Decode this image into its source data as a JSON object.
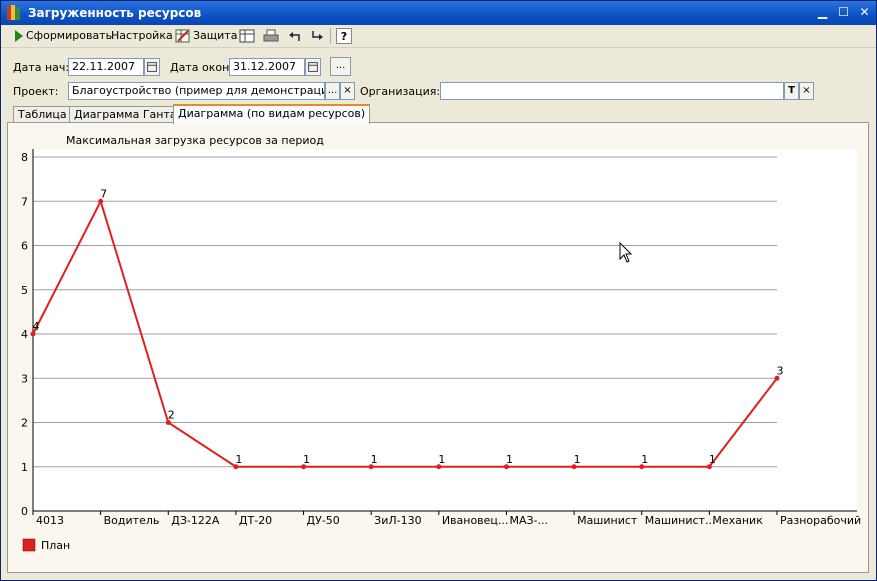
{
  "window": {
    "title": "Загруженность ресурсов"
  },
  "toolbar": {
    "form_label": "Сформировать",
    "settings_label": "Настройка",
    "protection_label": "Защита",
    "help_label": "?"
  },
  "filters": {
    "date_start_label": "Дата нач:",
    "date_start_value": "22.11.2007",
    "date_end_label": "Дата окон:",
    "date_end_value": "31.12.2007",
    "period_button": "...",
    "project_label": "Проект:",
    "project_value": "Благоустройство (пример для демонстрации)",
    "org_label": "Организация:",
    "org_value": "",
    "select_button": "...",
    "clear_button": "×",
    "type_button": "T"
  },
  "tabs": [
    {
      "label": "Таблица"
    },
    {
      "label": "Диаграмма Ганта"
    },
    {
      "label": "Диаграмма (по видам ресурсов)"
    }
  ],
  "colors": {
    "series": "#e02020",
    "grid": "#a0a0a0"
  },
  "chart_data": {
    "type": "line",
    "title": "Максимальная загрузка ресурсов за период",
    "categories": [
      "4013",
      "Водитель",
      "ДЗ-122А",
      "ДТ-20",
      "ДУ-50",
      "ЗиЛ-130",
      "Ивановец...",
      "МАЗ-...",
      "Машинист",
      "Машинист...",
      "Механик",
      "Разнорабочий"
    ],
    "series": [
      {
        "name": "План",
        "values": [
          4,
          7,
          2,
          1,
          1,
          1,
          1,
          1,
          1,
          1,
          1,
          3
        ]
      }
    ],
    "ylim": [
      0,
      8
    ],
    "yticks": [
      "0",
      "1",
      "2",
      "3",
      "4",
      "5",
      "6",
      "7",
      "8"
    ],
    "grid": true,
    "data_labels": true,
    "legend": "bottom-left"
  }
}
